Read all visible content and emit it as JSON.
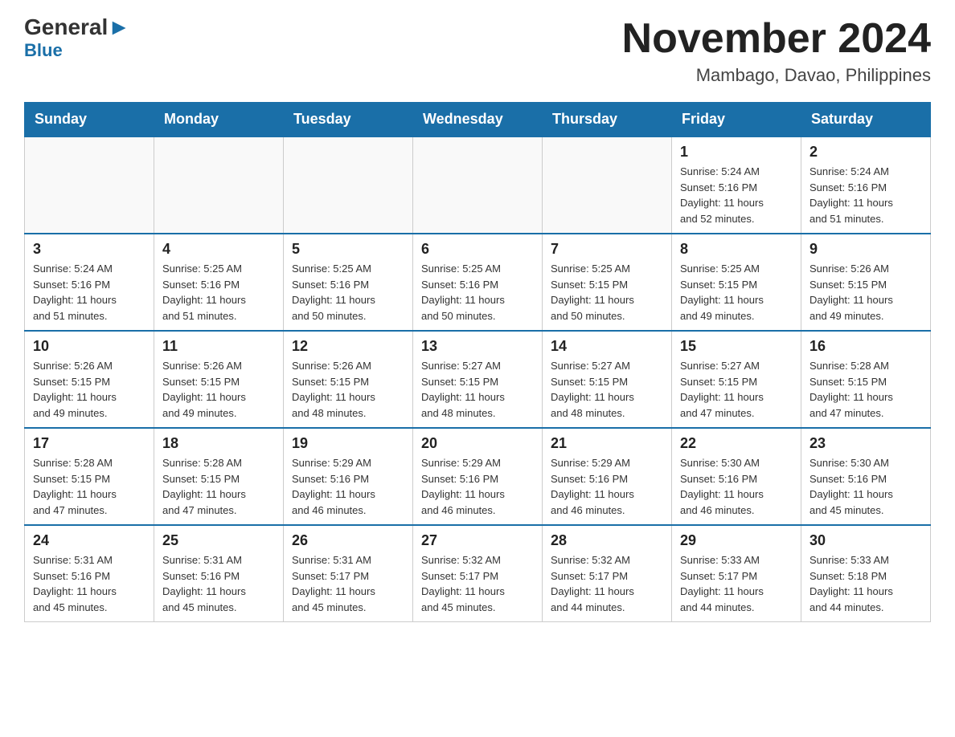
{
  "logo": {
    "general": "General",
    "blue": "Blue"
  },
  "title": "November 2024",
  "subtitle": "Mambago, Davao, Philippines",
  "days_of_week": [
    "Sunday",
    "Monday",
    "Tuesday",
    "Wednesday",
    "Thursday",
    "Friday",
    "Saturday"
  ],
  "weeks": [
    [
      {
        "day": "",
        "info": ""
      },
      {
        "day": "",
        "info": ""
      },
      {
        "day": "",
        "info": ""
      },
      {
        "day": "",
        "info": ""
      },
      {
        "day": "",
        "info": ""
      },
      {
        "day": "1",
        "info": "Sunrise: 5:24 AM\nSunset: 5:16 PM\nDaylight: 11 hours\nand 52 minutes."
      },
      {
        "day": "2",
        "info": "Sunrise: 5:24 AM\nSunset: 5:16 PM\nDaylight: 11 hours\nand 51 minutes."
      }
    ],
    [
      {
        "day": "3",
        "info": "Sunrise: 5:24 AM\nSunset: 5:16 PM\nDaylight: 11 hours\nand 51 minutes."
      },
      {
        "day": "4",
        "info": "Sunrise: 5:25 AM\nSunset: 5:16 PM\nDaylight: 11 hours\nand 51 minutes."
      },
      {
        "day": "5",
        "info": "Sunrise: 5:25 AM\nSunset: 5:16 PM\nDaylight: 11 hours\nand 50 minutes."
      },
      {
        "day": "6",
        "info": "Sunrise: 5:25 AM\nSunset: 5:16 PM\nDaylight: 11 hours\nand 50 minutes."
      },
      {
        "day": "7",
        "info": "Sunrise: 5:25 AM\nSunset: 5:15 PM\nDaylight: 11 hours\nand 50 minutes."
      },
      {
        "day": "8",
        "info": "Sunrise: 5:25 AM\nSunset: 5:15 PM\nDaylight: 11 hours\nand 49 minutes."
      },
      {
        "day": "9",
        "info": "Sunrise: 5:26 AM\nSunset: 5:15 PM\nDaylight: 11 hours\nand 49 minutes."
      }
    ],
    [
      {
        "day": "10",
        "info": "Sunrise: 5:26 AM\nSunset: 5:15 PM\nDaylight: 11 hours\nand 49 minutes."
      },
      {
        "day": "11",
        "info": "Sunrise: 5:26 AM\nSunset: 5:15 PM\nDaylight: 11 hours\nand 49 minutes."
      },
      {
        "day": "12",
        "info": "Sunrise: 5:26 AM\nSunset: 5:15 PM\nDaylight: 11 hours\nand 48 minutes."
      },
      {
        "day": "13",
        "info": "Sunrise: 5:27 AM\nSunset: 5:15 PM\nDaylight: 11 hours\nand 48 minutes."
      },
      {
        "day": "14",
        "info": "Sunrise: 5:27 AM\nSunset: 5:15 PM\nDaylight: 11 hours\nand 48 minutes."
      },
      {
        "day": "15",
        "info": "Sunrise: 5:27 AM\nSunset: 5:15 PM\nDaylight: 11 hours\nand 47 minutes."
      },
      {
        "day": "16",
        "info": "Sunrise: 5:28 AM\nSunset: 5:15 PM\nDaylight: 11 hours\nand 47 minutes."
      }
    ],
    [
      {
        "day": "17",
        "info": "Sunrise: 5:28 AM\nSunset: 5:15 PM\nDaylight: 11 hours\nand 47 minutes."
      },
      {
        "day": "18",
        "info": "Sunrise: 5:28 AM\nSunset: 5:15 PM\nDaylight: 11 hours\nand 47 minutes."
      },
      {
        "day": "19",
        "info": "Sunrise: 5:29 AM\nSunset: 5:16 PM\nDaylight: 11 hours\nand 46 minutes."
      },
      {
        "day": "20",
        "info": "Sunrise: 5:29 AM\nSunset: 5:16 PM\nDaylight: 11 hours\nand 46 minutes."
      },
      {
        "day": "21",
        "info": "Sunrise: 5:29 AM\nSunset: 5:16 PM\nDaylight: 11 hours\nand 46 minutes."
      },
      {
        "day": "22",
        "info": "Sunrise: 5:30 AM\nSunset: 5:16 PM\nDaylight: 11 hours\nand 46 minutes."
      },
      {
        "day": "23",
        "info": "Sunrise: 5:30 AM\nSunset: 5:16 PM\nDaylight: 11 hours\nand 45 minutes."
      }
    ],
    [
      {
        "day": "24",
        "info": "Sunrise: 5:31 AM\nSunset: 5:16 PM\nDaylight: 11 hours\nand 45 minutes."
      },
      {
        "day": "25",
        "info": "Sunrise: 5:31 AM\nSunset: 5:16 PM\nDaylight: 11 hours\nand 45 minutes."
      },
      {
        "day": "26",
        "info": "Sunrise: 5:31 AM\nSunset: 5:17 PM\nDaylight: 11 hours\nand 45 minutes."
      },
      {
        "day": "27",
        "info": "Sunrise: 5:32 AM\nSunset: 5:17 PM\nDaylight: 11 hours\nand 45 minutes."
      },
      {
        "day": "28",
        "info": "Sunrise: 5:32 AM\nSunset: 5:17 PM\nDaylight: 11 hours\nand 44 minutes."
      },
      {
        "day": "29",
        "info": "Sunrise: 5:33 AM\nSunset: 5:17 PM\nDaylight: 11 hours\nand 44 minutes."
      },
      {
        "day": "30",
        "info": "Sunrise: 5:33 AM\nSunset: 5:18 PM\nDaylight: 11 hours\nand 44 minutes."
      }
    ]
  ]
}
